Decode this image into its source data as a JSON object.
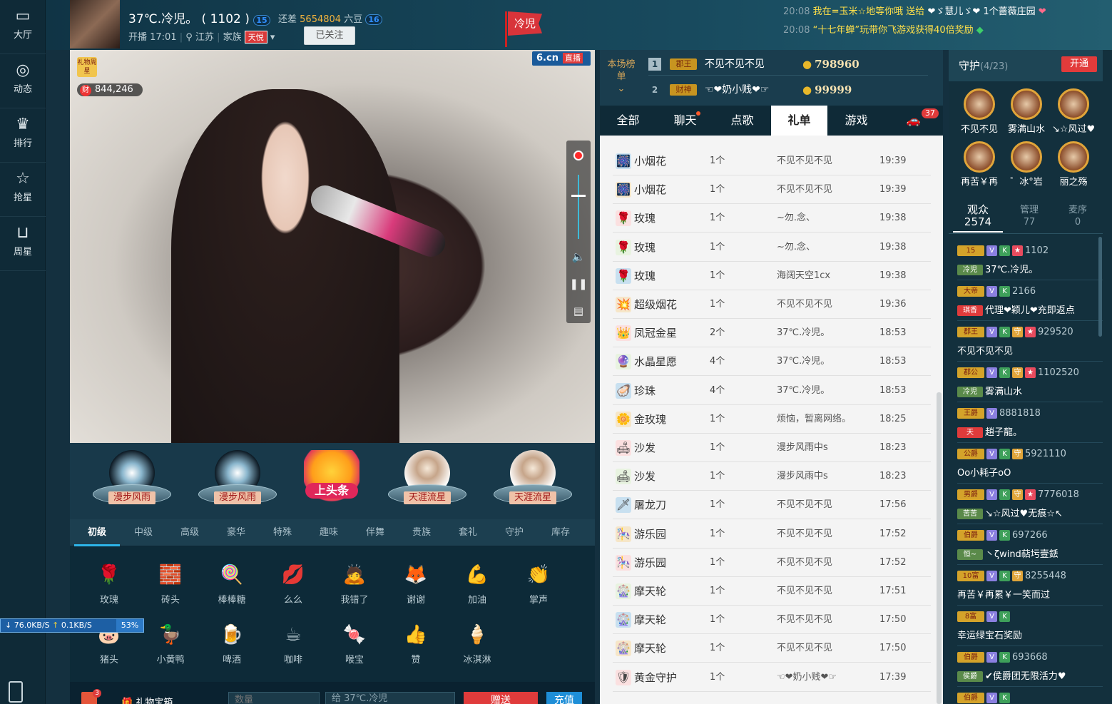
{
  "nav": {
    "items": [
      {
        "label": "大厅",
        "icon": "tv-icon"
      },
      {
        "label": "动态",
        "icon": "compass-icon"
      },
      {
        "label": "排行",
        "icon": "crown-icon"
      },
      {
        "label": "抢星",
        "icon": "star-icon"
      },
      {
        "label": "周星",
        "icon": "gift-basket-icon"
      }
    ]
  },
  "header": {
    "room_name": "37℃.冷児。",
    "room_id": "( 1102 )",
    "level_cur": "15",
    "gap_text": "还差",
    "gap_value": "5654804",
    "gap_unit": "六豆",
    "level_next": "16",
    "start_time": "开播 17:01",
    "location": "江苏",
    "family_label": "家族",
    "family_badge": "天悦",
    "follow_label": "已关注",
    "flag_text": "冷児"
  },
  "messages": [
    {
      "time": "20:08",
      "text_a": "我在=玉米☆地等你哦 送给",
      "text_b": "❤ゞ慧儿ゞ❤ 1个蔷薇庄园"
    },
    {
      "time": "20:08",
      "text_a": "“十七年蝉”玩带你飞游戏获得40倍奖励",
      "text_b": ""
    }
  ],
  "video": {
    "gift_week_label": "礼物周星",
    "wealth_icon": "财",
    "wealth_value": "844,246",
    "logo": "6.cn",
    "logo_tag": "直播",
    "controls": [
      "record-icon",
      "volume-slider",
      "speaker-icon",
      "pause-icon",
      "subtitle-icon"
    ]
  },
  "headlines": [
    {
      "name": "漫步风雨"
    },
    {
      "name": "漫步风雨"
    },
    {
      "name": "上头条"
    },
    {
      "name": "天涯流星"
    },
    {
      "name": "天涯流星"
    }
  ],
  "gift_tabs": [
    "初级",
    "中级",
    "高级",
    "豪华",
    "特殊",
    "趣味",
    "伴舞",
    "贵族",
    "套礼",
    "守护",
    "库存"
  ],
  "gifts": [
    {
      "name": "玫瑰",
      "icon": "🌹"
    },
    {
      "name": "砖头",
      "icon": "🧱"
    },
    {
      "name": "棒棒糖",
      "icon": "🍭"
    },
    {
      "name": "么么",
      "icon": "💋"
    },
    {
      "name": "我错了",
      "icon": "🙇"
    },
    {
      "name": "谢谢",
      "icon": "🦊"
    },
    {
      "name": "加油",
      "icon": "💪"
    },
    {
      "name": "掌声",
      "icon": "👏"
    },
    {
      "name": "猪头",
      "icon": "🐷"
    },
    {
      "name": "小黄鸭",
      "icon": "🦆"
    },
    {
      "name": "啤酒",
      "icon": "🍺"
    },
    {
      "name": "咖啡",
      "icon": "☕"
    },
    {
      "name": "喉宝",
      "icon": "🍬"
    },
    {
      "name": "赞",
      "icon": "👍"
    },
    {
      "name": "冰淇淋",
      "icon": "🍦"
    }
  ],
  "speed": {
    "down": "76.0KB/S",
    "up": "0.1KB/S",
    "pct": "53%"
  },
  "bottom": {
    "gift_count_badge": "3",
    "gift_box_label": "礼物宝箱",
    "qty_placeholder": "数量",
    "to_label": "给 37℃.冷児",
    "send_label": "赠送",
    "recharge_label": "充值"
  },
  "rank": {
    "label": "本场榜单",
    "rows": [
      {
        "no": "1",
        "tag": "郡王",
        "name": "不见不见不见",
        "score": "798960"
      },
      {
        "no": "2",
        "tag": "财神",
        "name": "☜❤奶小贱❤☞",
        "score": "99999"
      }
    ]
  },
  "chat_tabs": [
    {
      "label": "全部"
    },
    {
      "label": "聊天"
    },
    {
      "label": "点歌"
    },
    {
      "label": "礼单"
    },
    {
      "label": "游戏"
    },
    {
      "label": "37"
    }
  ],
  "gift_log": [
    {
      "icon": "🎆",
      "gift": "小烟花",
      "count": "1个",
      "user": "不见不见不见",
      "time": "19:39"
    },
    {
      "icon": "🎆",
      "gift": "小烟花",
      "count": "1个",
      "user": "不见不见不见",
      "time": "19:39"
    },
    {
      "icon": "🌹",
      "gift": "玫瑰",
      "count": "1个",
      "user": "~勿.念、",
      "time": "19:38"
    },
    {
      "icon": "🌹",
      "gift": "玫瑰",
      "count": "1个",
      "user": "~勿.念、",
      "time": "19:38"
    },
    {
      "icon": "🌹",
      "gift": "玫瑰",
      "count": "1个",
      "user": "海阔天空1cx",
      "time": "19:38"
    },
    {
      "icon": "💥",
      "gift": "超级烟花",
      "count": "1个",
      "user": "不见不见不见",
      "time": "19:36"
    },
    {
      "icon": "👑",
      "gift": "凤冠金星",
      "count": "2个",
      "user": "37℃.冷児。",
      "time": "18:53"
    },
    {
      "icon": "🔮",
      "gift": "水晶星愿",
      "count": "4个",
      "user": "37℃.冷児。",
      "time": "18:53"
    },
    {
      "icon": "🦪",
      "gift": "珍珠",
      "count": "4个",
      "user": "37℃.冷児。",
      "time": "18:53"
    },
    {
      "icon": "🌼",
      "gift": "金玫瑰",
      "count": "1个",
      "user": "烦恼，暂离网络。",
      "time": "18:25"
    },
    {
      "icon": "🛋",
      "gift": "沙发",
      "count": "1个",
      "user": "漫步风雨中s",
      "time": "18:23"
    },
    {
      "icon": "🛋",
      "gift": "沙发",
      "count": "1个",
      "user": "漫步风雨中s",
      "time": "18:23"
    },
    {
      "icon": "🗡",
      "gift": "屠龙刀",
      "count": "1个",
      "user": "不见不见不见",
      "time": "17:56"
    },
    {
      "icon": "🎠",
      "gift": "游乐园",
      "count": "1个",
      "user": "不见不见不见",
      "time": "17:52"
    },
    {
      "icon": "🎠",
      "gift": "游乐园",
      "count": "1个",
      "user": "不见不见不见",
      "time": "17:52"
    },
    {
      "icon": "🎡",
      "gift": "摩天轮",
      "count": "1个",
      "user": "不见不见不见",
      "time": "17:51"
    },
    {
      "icon": "🎡",
      "gift": "摩天轮",
      "count": "1个",
      "user": "不见不见不见",
      "time": "17:50"
    },
    {
      "icon": "🎡",
      "gift": "摩天轮",
      "count": "1个",
      "user": "不见不见不见",
      "time": "17:50"
    },
    {
      "icon": "🛡",
      "gift": "黄金守护",
      "count": "1个",
      "user": "☜❤奶小贱❤☞",
      "time": "17:39"
    }
  ],
  "guard": {
    "title": "守护",
    "count": "(4/23)",
    "open_label": "开通",
    "members": [
      "不见不见",
      "雾满山水",
      "↘☆风过♥",
      "再苦￥再",
      "゛冰°岩",
      "丽之殇"
    ]
  },
  "audience_tabs": [
    {
      "label": "观众",
      "count": "2574"
    },
    {
      "label": "管理",
      "count": "77"
    },
    {
      "label": "麦序",
      "count": "0"
    }
  ],
  "audience": [
    {
      "badge": "15",
      "id": "1102",
      "sub": "冷児",
      "name": "37℃.冷児。",
      "tags": [
        "v",
        "k",
        "r"
      ]
    },
    {
      "badge": "大帝",
      "id": "2166",
      "sub": "琪香",
      "name": "代理❤颖儿❤充即返点",
      "tags": [
        "v",
        "k"
      ]
    },
    {
      "badge": "郡王",
      "id": "929520",
      "sub": "",
      "name": "不见不见不见",
      "tags": [
        "v",
        "k",
        "s",
        "r"
      ]
    },
    {
      "badge": "郡公",
      "id": "1102520",
      "sub": "冷児",
      "name": "雾满山水",
      "tags": [
        "v",
        "k",
        "s",
        "r"
      ]
    },
    {
      "badge": "王爵",
      "id": "8881818",
      "sub": "天",
      "name": "趙子龍。",
      "tags": [
        "v"
      ]
    },
    {
      "badge": "公爵",
      "id": "5921110",
      "sub": "",
      "name": "Oo小耗子oO",
      "tags": [
        "v",
        "k",
        "s"
      ]
    },
    {
      "badge": "男爵",
      "id": "7776018",
      "sub": "苦苦",
      "name": "↘☆风过♥无痕☆↖",
      "tags": [
        "v",
        "k",
        "s",
        "r"
      ]
    },
    {
      "badge": "伯爵",
      "id": "697266",
      "sub": "恒~",
      "name": "丶ζwind萜圬壹銩",
      "tags": [
        "v",
        "k"
      ]
    },
    {
      "badge": "10富",
      "id": "8255448",
      "sub": "",
      "name": "再苦￥再累￥一笑而过",
      "tags": [
        "v",
        "k",
        "s"
      ]
    },
    {
      "badge": "8富",
      "id": "",
      "sub": "",
      "name": "幸运绿宝石奖励",
      "tags": [
        "v",
        "k"
      ]
    },
    {
      "badge": "伯爵",
      "id": "693668",
      "sub": "侯爵",
      "name": "✔侯爵团无限活力♥",
      "tags": [
        "v",
        "k"
      ]
    },
    {
      "badge": "伯爵",
      "id": "",
      "sub": "",
      "name": "",
      "tags": [
        "v",
        "k"
      ]
    }
  ]
}
